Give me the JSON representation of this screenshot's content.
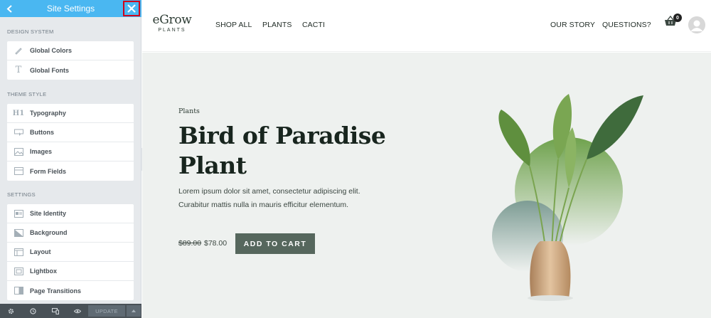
{
  "sidebar": {
    "title": "Site Settings",
    "back_icon": "chevron-left-icon",
    "close_icon": "close-icon",
    "sections": [
      {
        "label": "DESIGN SYSTEM",
        "items": [
          {
            "label": "Global Colors",
            "icon": "brush-icon"
          },
          {
            "label": "Global Fonts",
            "icon": "font-icon"
          }
        ]
      },
      {
        "label": "THEME STYLE",
        "items": [
          {
            "label": "Typography",
            "icon": "heading-icon"
          },
          {
            "label": "Buttons",
            "icon": "button-icon"
          },
          {
            "label": "Images",
            "icon": "image-icon"
          },
          {
            "label": "Form Fields",
            "icon": "form-icon"
          }
        ]
      },
      {
        "label": "SETTINGS",
        "items": [
          {
            "label": "Site Identity",
            "icon": "id-card-icon"
          },
          {
            "label": "Background",
            "icon": "background-icon"
          },
          {
            "label": "Layout",
            "icon": "layout-icon"
          },
          {
            "label": "Lightbox",
            "icon": "lightbox-icon"
          },
          {
            "label": "Page Transitions",
            "icon": "transition-icon"
          }
        ]
      }
    ],
    "footer": {
      "update_label": "UPDATE"
    }
  },
  "site": {
    "logo_brand": "eGrow",
    "logo_sub": "PLANTS",
    "nav_left": [
      "SHOP ALL",
      "PLANTS",
      "CACTI"
    ],
    "nav_right": [
      "OUR STORY",
      "QUESTIONS?"
    ],
    "cart_count": "0",
    "accent": "#56675d",
    "hero_bg": "#eef1ef",
    "product": {
      "category": "Plants",
      "title": "Bird of Paradise Plant",
      "description": "Lorem ipsum dolor sit amet, consectetur adipiscing elit. Curabitur mattis nulla in mauris efficitur elementum.",
      "price_old": "$89.00",
      "price_new": "$78.00",
      "cta": "ADD TO CART"
    }
  }
}
